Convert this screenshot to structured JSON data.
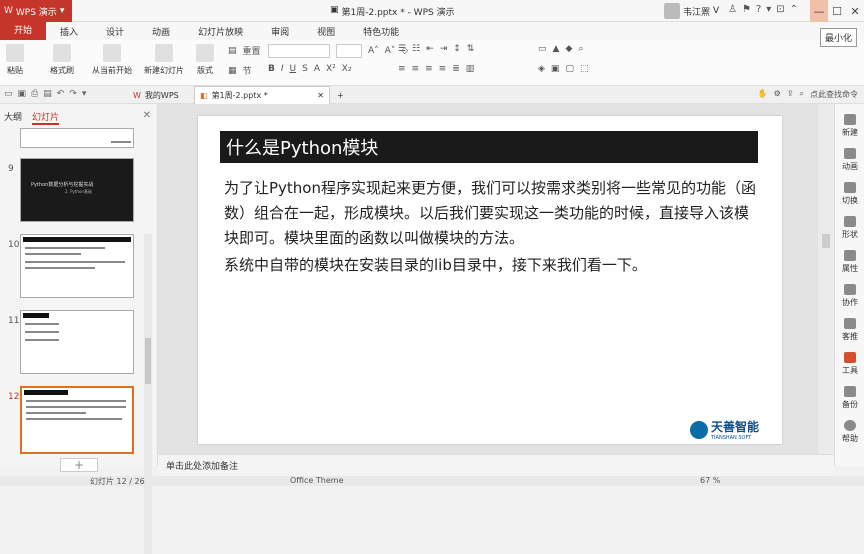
{
  "app": {
    "title": "WPS 演示",
    "document_title": "第1周-2.pptx * - WPS 演示",
    "user": "韦江罴"
  },
  "window": {
    "minimize_tooltip": "最小化"
  },
  "menu": [
    "开始",
    "插入",
    "设计",
    "动画",
    "幻灯片放映",
    "审阅",
    "视图",
    "特色功能"
  ],
  "ribbon": {
    "paste": "粘贴",
    "format_painter": "格式刷",
    "from_current": "从当前开始",
    "new_slide": "新建幻灯片",
    "layout": "版式",
    "section": "节",
    "reset": "重置"
  },
  "tabs": [
    {
      "label": "我的WPS"
    },
    {
      "label": "第1周-2.pptx *"
    }
  ],
  "right_ops": {
    "search": "点此查找命令"
  },
  "left_panel": {
    "tab_outline": "大纲",
    "tab_slides": "幻灯片",
    "slide_numbers": [
      "9",
      "10",
      "11",
      "12"
    ],
    "thumb9_line1": "Python数据分析与挖掘实战",
    "thumb9_line2": "2. Python基础"
  },
  "slide": {
    "title": "什么是Python模块",
    "para1": "为了让Python程序实现起来更方便，我们可以按需求类别将一些常见的功能（函数）组合在一起，形成模块。以后我们要实现这一类功能的时候，直接导入该模块即可。模块里面的函数以叫做模块的方法。",
    "para2": "系统中自带的模块在安装目录的lib目录中，接下来我们看一下。",
    "logo_cn": "天善智能",
    "logo_en": "TIANSHAN SOFT"
  },
  "right_sidebar": [
    "新建",
    "动画",
    "切换",
    "形状",
    "属性",
    "协作",
    "客推",
    "工具",
    "备份",
    "帮助"
  ],
  "notes": {
    "placeholder": "单击此处添加备注"
  },
  "status": {
    "slide_count": "幻灯片 12 / 26",
    "theme": "Office Theme",
    "zoom": "67 %"
  }
}
